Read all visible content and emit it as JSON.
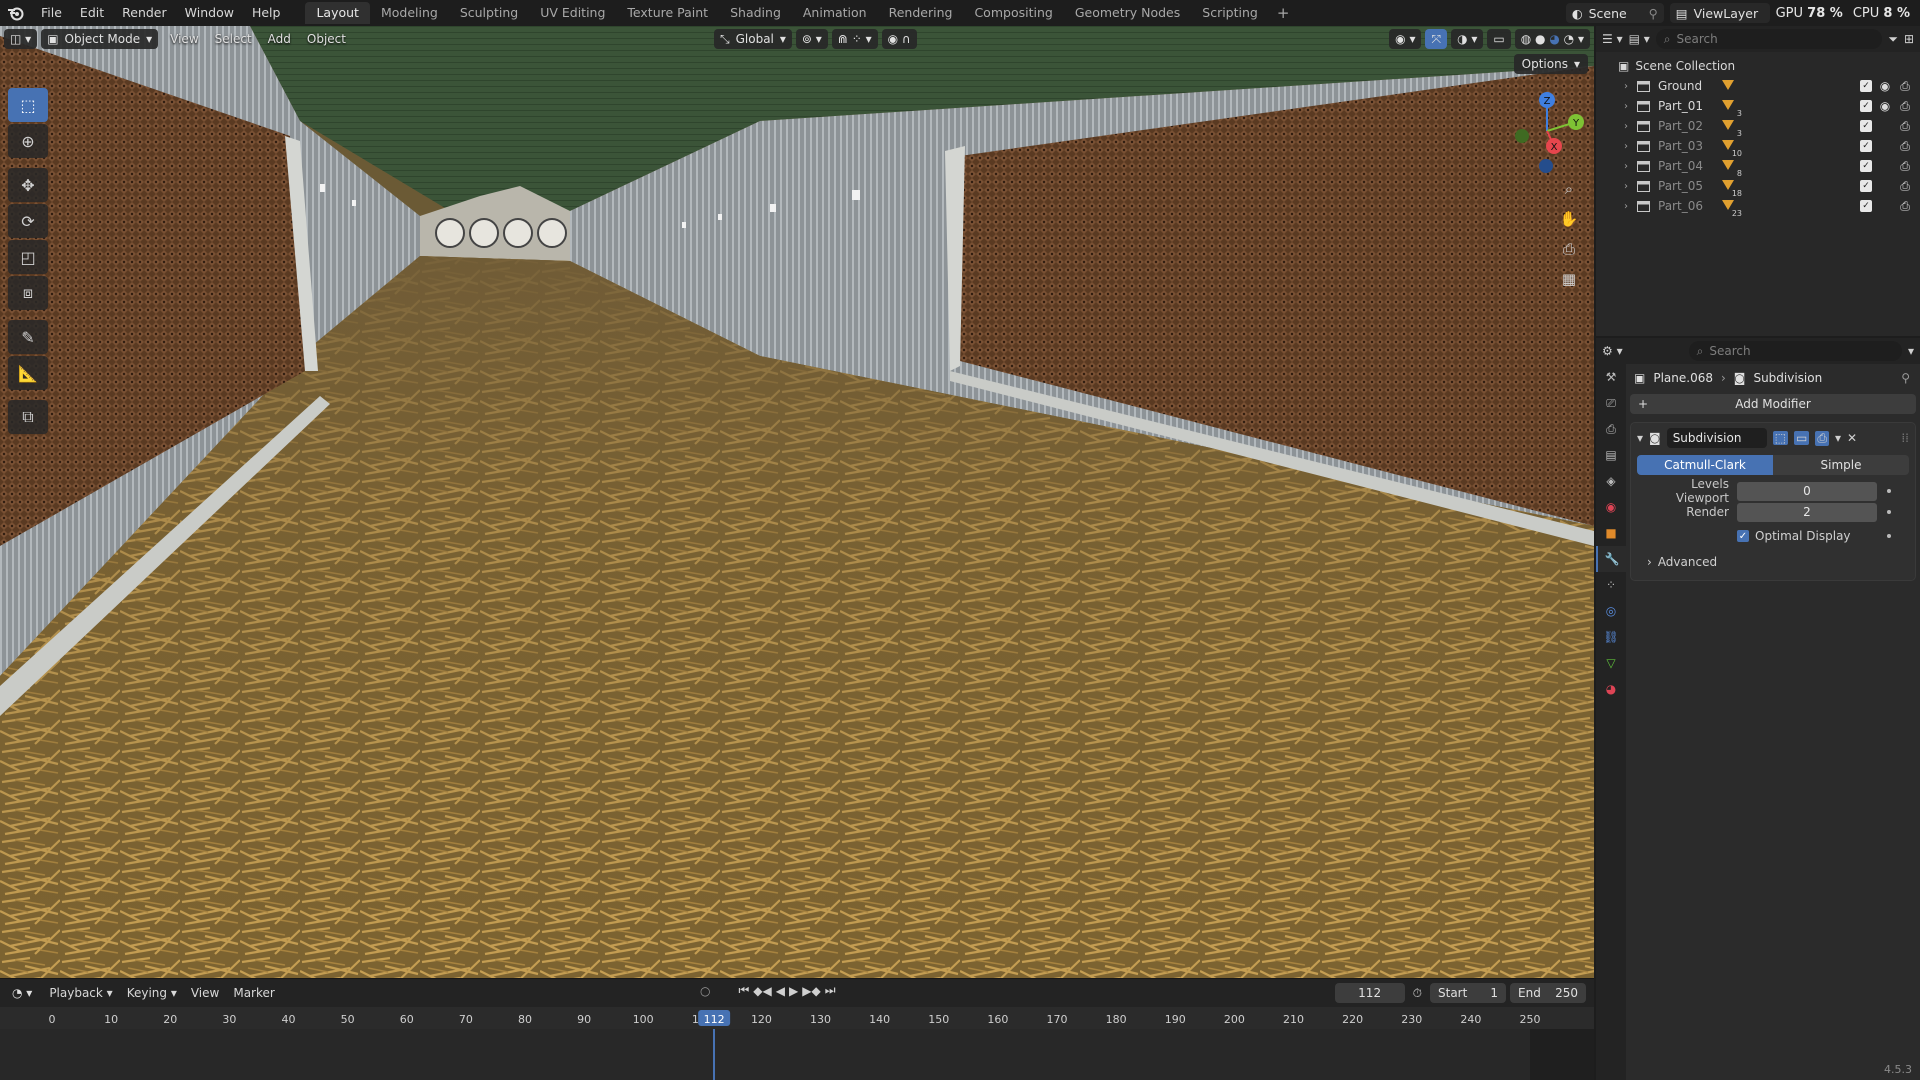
{
  "app": {
    "menu": [
      "File",
      "Edit",
      "Render",
      "Window",
      "Help"
    ],
    "workspaces": [
      "Layout",
      "Modeling",
      "Sculpting",
      "UV Editing",
      "Texture Paint",
      "Shading",
      "Animation",
      "Rendering",
      "Compositing",
      "Geometry Nodes",
      "Scripting"
    ],
    "active_workspace": "Layout",
    "add_workspace": "+",
    "scene": "Scene",
    "view_layer": "ViewLayer",
    "gpu_label": "GPU",
    "gpu_value": "78 %",
    "cpu_label": "CPU",
    "cpu_value": "8 %"
  },
  "viewport": {
    "mode": "Object Mode",
    "menus": [
      "View",
      "Select",
      "Add",
      "Object"
    ],
    "orientation": "Global",
    "options": "Options",
    "gizmo_axes": {
      "x": "X",
      "y": "Y",
      "z": "Z"
    }
  },
  "timeline": {
    "menus": [
      "Playback",
      "Keying",
      "View",
      "Marker"
    ],
    "current_frame": "112",
    "start_label": "Start",
    "start": "1",
    "end_label": "End",
    "end": "250",
    "ruler": [
      "0",
      "10",
      "20",
      "30",
      "40",
      "50",
      "60",
      "70",
      "80",
      "90",
      "100",
      "110",
      "120",
      "130",
      "140",
      "150",
      "160",
      "170",
      "180",
      "190",
      "200",
      "210",
      "220",
      "230",
      "240",
      "250"
    ],
    "playhead_label": "112",
    "playhead_frame": 112
  },
  "outliner": {
    "search_placeholder": "Search",
    "root": "Scene Collection",
    "items": [
      {
        "name": "Ground",
        "badge": "",
        "dim": false,
        "visible": true
      },
      {
        "name": "Part_01",
        "badge": "3",
        "dim": false,
        "visible": true
      },
      {
        "name": "Part_02",
        "badge": "3",
        "dim": true,
        "visible": false
      },
      {
        "name": "Part_03",
        "badge": "10",
        "dim": true,
        "visible": false
      },
      {
        "name": "Part_04",
        "badge": "8",
        "dim": true,
        "visible": false
      },
      {
        "name": "Part_05",
        "badge": "18",
        "dim": true,
        "visible": false
      },
      {
        "name": "Part_06",
        "badge": "23",
        "dim": true,
        "visible": false
      }
    ]
  },
  "properties": {
    "search_placeholder": "Search",
    "object": "Plane.068",
    "modifier_breadcrumb": "Subdivision",
    "add_modifier": "Add Modifier",
    "modifier": {
      "name": "Subdivision",
      "type_options": [
        "Catmull-Clark",
        "Simple"
      ],
      "active_type": "Catmull-Clark",
      "levels_viewport_label": "Levels Viewport",
      "levels_viewport": "0",
      "render_label": "Render",
      "render": "2",
      "optimal_display_label": "Optimal Display",
      "optimal_display": true,
      "advanced": "Advanced"
    },
    "version": "4.5.3"
  },
  "colors": {
    "accent": "#4772b3",
    "axis_x": "#e6464d",
    "axis_y": "#7ec234",
    "axis_z": "#3f7fe0",
    "floor": "#8a6d34",
    "ceiling": "#3c5a3a",
    "wall_pad": "#6b4226"
  }
}
